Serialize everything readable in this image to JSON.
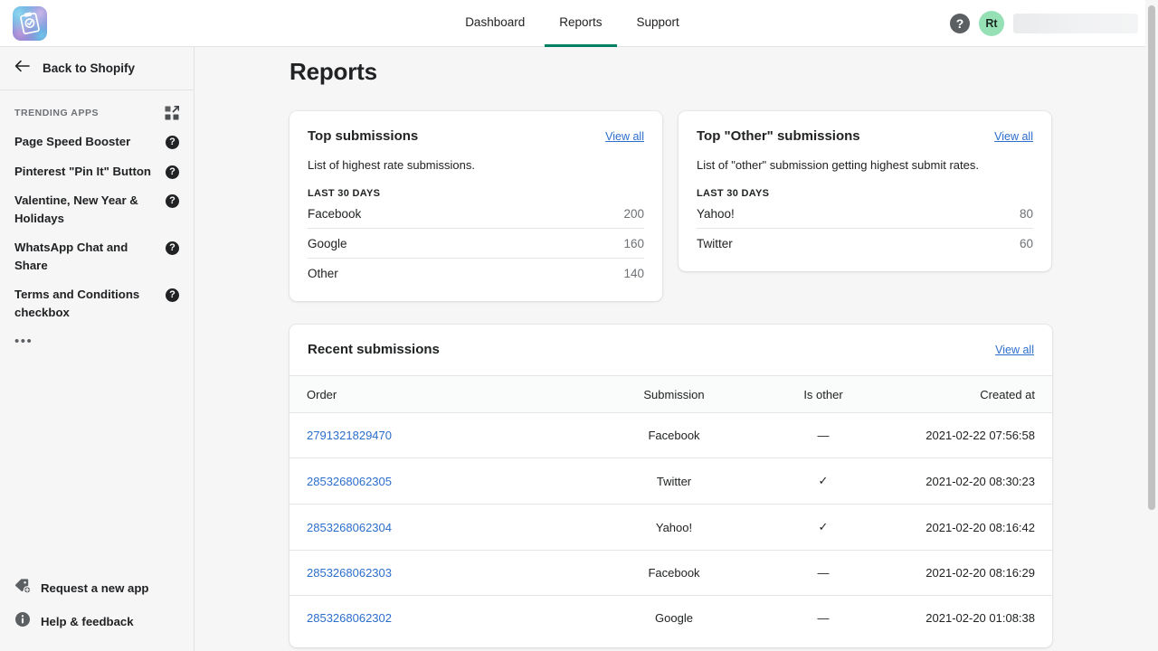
{
  "topbar": {
    "logo_alt": "app-logo",
    "nav": [
      {
        "label": "Dashboard",
        "active": false
      },
      {
        "label": "Reports",
        "active": true
      },
      {
        "label": "Support",
        "active": false
      }
    ],
    "help_label": "?",
    "avatar_initials": "Rt"
  },
  "sidebar": {
    "back_label": "Back to Shopify",
    "trending_title": "TRENDING APPS",
    "apps": [
      {
        "label": "Page Speed Booster",
        "badge": "?"
      },
      {
        "label": "Pinterest \"Pin It\" Button",
        "badge": "?"
      },
      {
        "label": "Valentine, New Year & Holidays",
        "badge": "?"
      },
      {
        "label": "WhatsApp Chat and Share",
        "badge": "?"
      },
      {
        "label": "Terms and Conditions checkbox",
        "badge": "?"
      }
    ],
    "more_label": "•••",
    "bottom": [
      {
        "label": "Request a new app",
        "icon": "tag-plus-icon"
      },
      {
        "label": "Help & feedback",
        "icon": "info-circle-icon"
      }
    ]
  },
  "main": {
    "page_title": "Reports",
    "top_submissions": {
      "title": "Top submissions",
      "view_all": "View all",
      "subtitle": "List of highest rate submissions.",
      "kicker": "LAST 30 DAYS",
      "rows": [
        {
          "label": "Facebook",
          "value": "200"
        },
        {
          "label": "Google",
          "value": "160"
        },
        {
          "label": "Other",
          "value": "140"
        }
      ]
    },
    "top_other_submissions": {
      "title": "Top \"Other\" submissions",
      "view_all": "View all",
      "subtitle": "List of \"other\" submission getting highest submit rates.",
      "kicker": "LAST 30 DAYS",
      "rows": [
        {
          "label": "Yahoo!",
          "value": "80"
        },
        {
          "label": "Twitter",
          "value": "60"
        }
      ]
    },
    "recent_submissions": {
      "title": "Recent submissions",
      "view_all": "View all",
      "columns": [
        "Order",
        "Submission",
        "Is other",
        "Created at"
      ],
      "rows": [
        {
          "order": "2791321829470",
          "submission": "Facebook",
          "is_other": "—",
          "created_at": "2021-02-22 07:56:58"
        },
        {
          "order": "2853268062305",
          "submission": "Twitter",
          "is_other": "✓",
          "created_at": "2021-02-20 08:30:23"
        },
        {
          "order": "2853268062304",
          "submission": "Yahoo!",
          "is_other": "✓",
          "created_at": "2021-02-20 08:16:42"
        },
        {
          "order": "2853268062303",
          "submission": "Facebook",
          "is_other": "—",
          "created_at": "2021-02-20 08:16:29"
        },
        {
          "order": "2853268062302",
          "submission": "Google",
          "is_other": "—",
          "created_at": "2021-02-20 01:08:38"
        }
      ]
    }
  },
  "colors": {
    "accent_green": "#008060",
    "link_blue": "#2c6ecb",
    "avatar_green": "#95e0b4",
    "surface": "#f6f6f7",
    "card": "#ffffff",
    "border": "#e1e3e5",
    "text": "#202223",
    "text_subdued": "#6d7175"
  }
}
